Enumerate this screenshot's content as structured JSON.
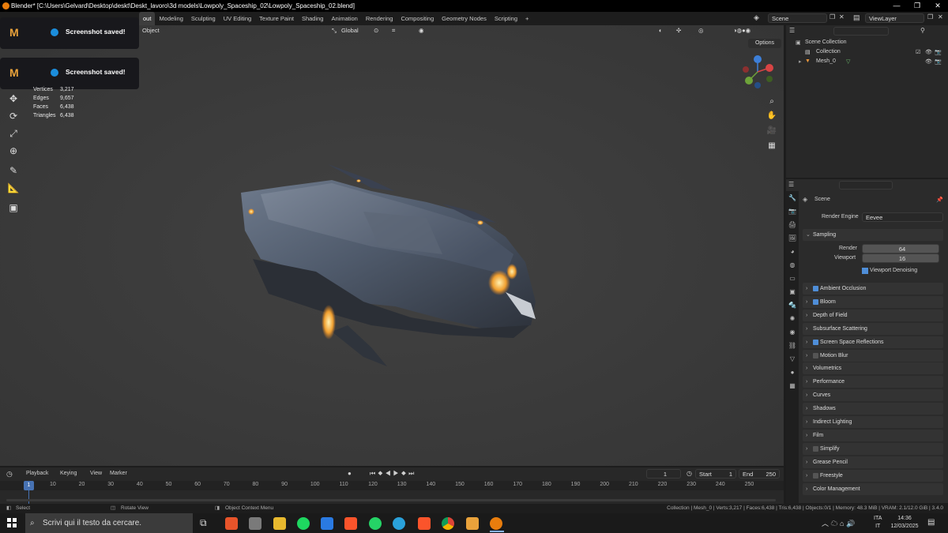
{
  "titlebar": {
    "title": "Blender* [C:\\Users\\Gelvard\\Desktop\\deskt\\Deskt_lavoro\\3d models\\Lowpoly_Spaceship_02\\Lowpoly_Spaceship_02.blend]"
  },
  "workspace_tabs": [
    "out",
    "Modeling",
    "Sculpting",
    "UV Editing",
    "Texture Paint",
    "Shading",
    "Animation",
    "Rendering",
    "Compositing",
    "Geometry Nodes",
    "Scripting",
    "+"
  ],
  "scene": {
    "scene_name": "Scene",
    "view_layer": "ViewLayer"
  },
  "viewport": {
    "mode_label": "Object",
    "orientation": "Global",
    "options": "Options"
  },
  "stats": [
    {
      "label": "Vertices",
      "value": "3,217"
    },
    {
      "label": "Edges",
      "value": "9,657"
    },
    {
      "label": "Faces",
      "value": "6,438"
    },
    {
      "label": "Triangles",
      "value": "6,438"
    }
  ],
  "toasts": [
    {
      "text": "Screenshot saved!"
    },
    {
      "text": "Screenshot saved!"
    }
  ],
  "outliner": {
    "scene_collection": "Scene Collection",
    "collection": "Collection",
    "mesh": "Mesh_0"
  },
  "properties": {
    "context": "Scene",
    "render_engine_label": "Render Engine",
    "render_engine": "Eevee",
    "sampling": "Sampling",
    "render_label": "Render",
    "render_value": "64",
    "viewport_label": "Viewport",
    "viewport_value": "16",
    "viewport_denoising": "Viewport Denoising",
    "panels": [
      {
        "label": "Ambient Occlusion",
        "checkbox": "on"
      },
      {
        "label": "Bloom",
        "checkbox": "on"
      },
      {
        "label": "Depth of Field",
        "checkbox": "none"
      },
      {
        "label": "Subsurface Scattering",
        "checkbox": "none"
      },
      {
        "label": "Screen Space Reflections",
        "checkbox": "on"
      },
      {
        "label": "Motion Blur",
        "checkbox": "off"
      },
      {
        "label": "Volumetrics",
        "checkbox": "none"
      },
      {
        "label": "Performance",
        "checkbox": "none"
      },
      {
        "label": "Curves",
        "checkbox": "none"
      },
      {
        "label": "Shadows",
        "checkbox": "none"
      },
      {
        "label": "Indirect Lighting",
        "checkbox": "none"
      },
      {
        "label": "Film",
        "checkbox": "none"
      },
      {
        "label": "Simplify",
        "checkbox": "off"
      },
      {
        "label": "Grease Pencil",
        "checkbox": "none"
      },
      {
        "label": "Freestyle",
        "checkbox": "off"
      },
      {
        "label": "Color Management",
        "checkbox": "none"
      }
    ]
  },
  "timeline": {
    "menus": [
      "Playback",
      "Keying",
      "View",
      "Marker"
    ],
    "current_frame": "1",
    "start_label": "Start",
    "start": "1",
    "end_label": "End",
    "end": "250",
    "ruler": [
      "1",
      "10",
      "20",
      "30",
      "40",
      "50",
      "60",
      "70",
      "80",
      "90",
      "100",
      "110",
      "120",
      "130",
      "140",
      "150",
      "160",
      "170",
      "180",
      "190",
      "200",
      "210",
      "220",
      "230",
      "240",
      "250"
    ]
  },
  "statusbar": {
    "select": "Select",
    "rotate": "Rotate View",
    "context": "Object Context Menu",
    "info": "Collection | Mesh_0 | Verts:3,217 | Faces:6,438 | Tris:6,438 | Objects:0/1 | Memory: 48.3 MiB | VRAM: 2.1/12.0 GiB | 3.4.0"
  },
  "taskbar": {
    "search_placeholder": "Scrivi qui il testo da cercare.",
    "lang": "ITA",
    "lang2": "IT",
    "time": "14:36",
    "date": "12/03/2025"
  }
}
